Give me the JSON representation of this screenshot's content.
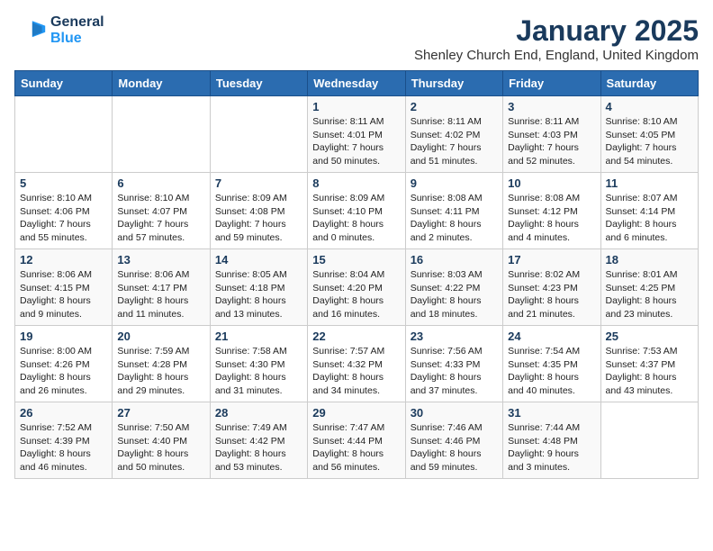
{
  "logo": {
    "line1": "General",
    "line2": "Blue"
  },
  "title": "January 2025",
  "location": "Shenley Church End, England, United Kingdom",
  "weekdays": [
    "Sunday",
    "Monday",
    "Tuesday",
    "Wednesday",
    "Thursday",
    "Friday",
    "Saturday"
  ],
  "weeks": [
    [
      {
        "day": "",
        "info": ""
      },
      {
        "day": "",
        "info": ""
      },
      {
        "day": "",
        "info": ""
      },
      {
        "day": "1",
        "info": "Sunrise: 8:11 AM\nSunset: 4:01 PM\nDaylight: 7 hours\nand 50 minutes."
      },
      {
        "day": "2",
        "info": "Sunrise: 8:11 AM\nSunset: 4:02 PM\nDaylight: 7 hours\nand 51 minutes."
      },
      {
        "day": "3",
        "info": "Sunrise: 8:11 AM\nSunset: 4:03 PM\nDaylight: 7 hours\nand 52 minutes."
      },
      {
        "day": "4",
        "info": "Sunrise: 8:10 AM\nSunset: 4:05 PM\nDaylight: 7 hours\nand 54 minutes."
      }
    ],
    [
      {
        "day": "5",
        "info": "Sunrise: 8:10 AM\nSunset: 4:06 PM\nDaylight: 7 hours\nand 55 minutes."
      },
      {
        "day": "6",
        "info": "Sunrise: 8:10 AM\nSunset: 4:07 PM\nDaylight: 7 hours\nand 57 minutes."
      },
      {
        "day": "7",
        "info": "Sunrise: 8:09 AM\nSunset: 4:08 PM\nDaylight: 7 hours\nand 59 minutes."
      },
      {
        "day": "8",
        "info": "Sunrise: 8:09 AM\nSunset: 4:10 PM\nDaylight: 8 hours\nand 0 minutes."
      },
      {
        "day": "9",
        "info": "Sunrise: 8:08 AM\nSunset: 4:11 PM\nDaylight: 8 hours\nand 2 minutes."
      },
      {
        "day": "10",
        "info": "Sunrise: 8:08 AM\nSunset: 4:12 PM\nDaylight: 8 hours\nand 4 minutes."
      },
      {
        "day": "11",
        "info": "Sunrise: 8:07 AM\nSunset: 4:14 PM\nDaylight: 8 hours\nand 6 minutes."
      }
    ],
    [
      {
        "day": "12",
        "info": "Sunrise: 8:06 AM\nSunset: 4:15 PM\nDaylight: 8 hours\nand 9 minutes."
      },
      {
        "day": "13",
        "info": "Sunrise: 8:06 AM\nSunset: 4:17 PM\nDaylight: 8 hours\nand 11 minutes."
      },
      {
        "day": "14",
        "info": "Sunrise: 8:05 AM\nSunset: 4:18 PM\nDaylight: 8 hours\nand 13 minutes."
      },
      {
        "day": "15",
        "info": "Sunrise: 8:04 AM\nSunset: 4:20 PM\nDaylight: 8 hours\nand 16 minutes."
      },
      {
        "day": "16",
        "info": "Sunrise: 8:03 AM\nSunset: 4:22 PM\nDaylight: 8 hours\nand 18 minutes."
      },
      {
        "day": "17",
        "info": "Sunrise: 8:02 AM\nSunset: 4:23 PM\nDaylight: 8 hours\nand 21 minutes."
      },
      {
        "day": "18",
        "info": "Sunrise: 8:01 AM\nSunset: 4:25 PM\nDaylight: 8 hours\nand 23 minutes."
      }
    ],
    [
      {
        "day": "19",
        "info": "Sunrise: 8:00 AM\nSunset: 4:26 PM\nDaylight: 8 hours\nand 26 minutes."
      },
      {
        "day": "20",
        "info": "Sunrise: 7:59 AM\nSunset: 4:28 PM\nDaylight: 8 hours\nand 29 minutes."
      },
      {
        "day": "21",
        "info": "Sunrise: 7:58 AM\nSunset: 4:30 PM\nDaylight: 8 hours\nand 31 minutes."
      },
      {
        "day": "22",
        "info": "Sunrise: 7:57 AM\nSunset: 4:32 PM\nDaylight: 8 hours\nand 34 minutes."
      },
      {
        "day": "23",
        "info": "Sunrise: 7:56 AM\nSunset: 4:33 PM\nDaylight: 8 hours\nand 37 minutes."
      },
      {
        "day": "24",
        "info": "Sunrise: 7:54 AM\nSunset: 4:35 PM\nDaylight: 8 hours\nand 40 minutes."
      },
      {
        "day": "25",
        "info": "Sunrise: 7:53 AM\nSunset: 4:37 PM\nDaylight: 8 hours\nand 43 minutes."
      }
    ],
    [
      {
        "day": "26",
        "info": "Sunrise: 7:52 AM\nSunset: 4:39 PM\nDaylight: 8 hours\nand 46 minutes."
      },
      {
        "day": "27",
        "info": "Sunrise: 7:50 AM\nSunset: 4:40 PM\nDaylight: 8 hours\nand 50 minutes."
      },
      {
        "day": "28",
        "info": "Sunrise: 7:49 AM\nSunset: 4:42 PM\nDaylight: 8 hours\nand 53 minutes."
      },
      {
        "day": "29",
        "info": "Sunrise: 7:47 AM\nSunset: 4:44 PM\nDaylight: 8 hours\nand 56 minutes."
      },
      {
        "day": "30",
        "info": "Sunrise: 7:46 AM\nSunset: 4:46 PM\nDaylight: 8 hours\nand 59 minutes."
      },
      {
        "day": "31",
        "info": "Sunrise: 7:44 AM\nSunset: 4:48 PM\nDaylight: 9 hours\nand 3 minutes."
      },
      {
        "day": "",
        "info": ""
      }
    ]
  ]
}
